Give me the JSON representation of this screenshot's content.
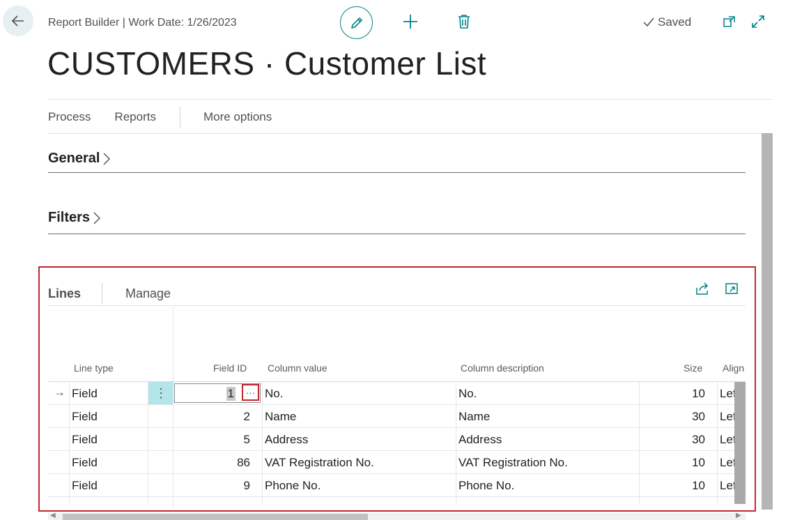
{
  "header": {
    "breadcrumb": "Report Builder | Work Date: 1/26/2023",
    "saved_label": "Saved",
    "page_title": "CUSTOMERS · Customer List"
  },
  "actions": {
    "process": "Process",
    "reports": "Reports",
    "more_options": "More options"
  },
  "sections": {
    "general": "General",
    "filters": "Filters"
  },
  "lines": {
    "title": "Lines",
    "manage": "Manage",
    "columns": {
      "line_type": "Line type",
      "field_id": "Field ID",
      "column_value": "Column value",
      "column_description": "Column description",
      "size": "Size",
      "align": "Align"
    },
    "rows": [
      {
        "line_type": "Field",
        "field_id": "1",
        "column_value": "No.",
        "column_description": "No.",
        "size": "10",
        "align": "Left"
      },
      {
        "line_type": "Field",
        "field_id": "2",
        "column_value": "Name",
        "column_description": "Name",
        "size": "30",
        "align": "Left"
      },
      {
        "line_type": "Field",
        "field_id": "5",
        "column_value": "Address",
        "column_description": "Address",
        "size": "30",
        "align": "Left"
      },
      {
        "line_type": "Field",
        "field_id": "86",
        "column_value": "VAT Registration No.",
        "column_description": "VAT Registration No.",
        "size": "10",
        "align": "Left"
      },
      {
        "line_type": "Field",
        "field_id": "9",
        "column_value": "Phone No.",
        "column_description": "Phone No.",
        "size": "10",
        "align": "Left"
      }
    ]
  },
  "icons": {
    "back": "arrow-left-icon",
    "edit": "pencil-icon",
    "new": "plus-icon",
    "delete": "trash-icon",
    "saved": "checkmark-icon",
    "popout": "open-in-new-window-icon",
    "expand": "expand-icon",
    "share": "share-icon",
    "focus": "focus-mode-icon"
  },
  "colors": {
    "accent": "#00808a",
    "highlight_border": "#c4262e",
    "selected_cell": "#b3e5ea"
  }
}
